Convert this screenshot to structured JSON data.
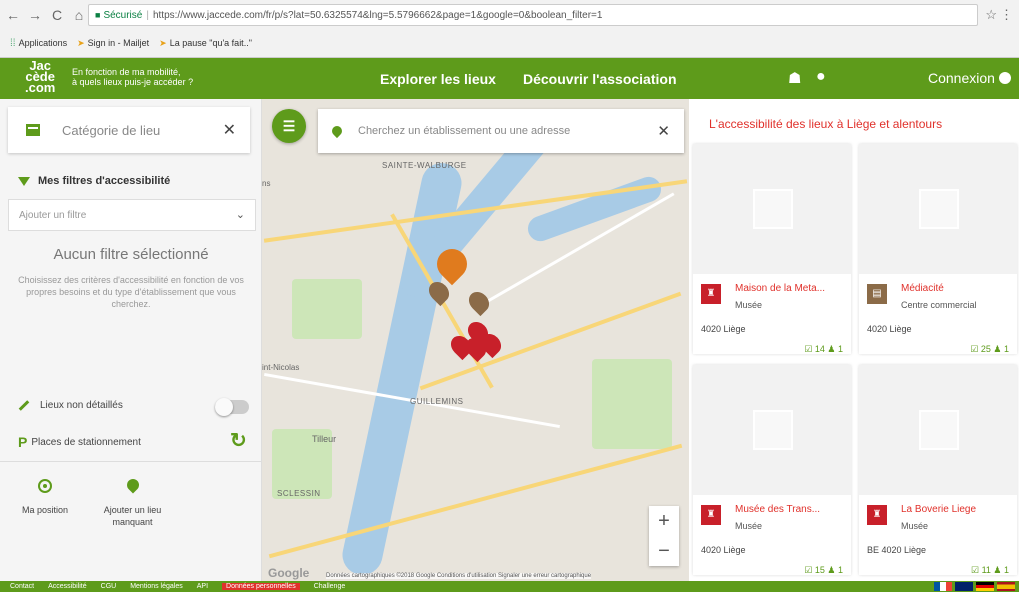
{
  "browser": {
    "secure": "Sécurisé",
    "url": "https://www.jaccede.com/fr/p/s?lat=50.6325574&lng=5.5796662&page=1&google=0&boolean_filter=1",
    "bookmarks": [
      "Applications",
      "Sign in - Mailjet",
      "La pause \"qu'a fait..\""
    ]
  },
  "header": {
    "logo": "Jac cède .com",
    "tagline1": "En fonction de ma mobilité,",
    "tagline2": "à quels lieux puis-je accéder ?",
    "nav": [
      "Explorer les lieux",
      "Découvrir l'association"
    ],
    "connexion": "Connexion"
  },
  "left": {
    "category_placeholder": "Catégorie de lieu",
    "filters_title": "Mes filtres d'accessibilité",
    "add_filter": "Ajouter un filtre",
    "no_filter": "Aucun filtre sélectionné",
    "no_filter_desc": "Choisissez des critères d'accessibilité en fonction de vos propres besoins et du type d'établissement que vous cherchez.",
    "lieux_non_detailles": "Lieux non détaillés",
    "places_stationnement": "Places de stationnement",
    "ma_position": "Ma position",
    "ajouter_lieu": "Ajouter un lieu manquant"
  },
  "map": {
    "search_placeholder": "Cherchez un établissement ou une adresse",
    "labels": [
      "SAINTE-WALBURGE",
      "GUILLEMINS",
      "Tilleur",
      "SCLESSIN",
      "int-Nicolas",
      "ns"
    ],
    "attribution": "Données cartographiques ©2018 Google   Conditions d'utilisation   Signaler une erreur cartographique",
    "google": "Google"
  },
  "right": {
    "title": "L'accessibilité des lieux à Liège et alentours",
    "cards": [
      {
        "name": "Maison de la Meta...",
        "type": "Musée",
        "city": "4020 Liège",
        "stats": "☑ 14  ♟ 1",
        "color": "#c8202a"
      },
      {
        "name": "Médiacité",
        "type": "Centre commercial",
        "city": "4020 Liège",
        "stats": "☑ 25  ♟ 1",
        "color": "#8b6b48"
      },
      {
        "name": "Musée des Trans...",
        "type": "Musée",
        "city": "4020 Liège",
        "stats": "☑ 15  ♟ 1",
        "color": "#c8202a"
      },
      {
        "name": "La Boverie Liege",
        "type": "Musée",
        "city": "BE 4020 Liège",
        "stats": "☑ 11  ♟ 1",
        "color": "#c8202a"
      }
    ]
  },
  "footer": {
    "links": [
      "Contact",
      "Accessibilité",
      "CGU",
      "Mentions légales",
      "API",
      "Données personnelles",
      "Challenge"
    ]
  }
}
